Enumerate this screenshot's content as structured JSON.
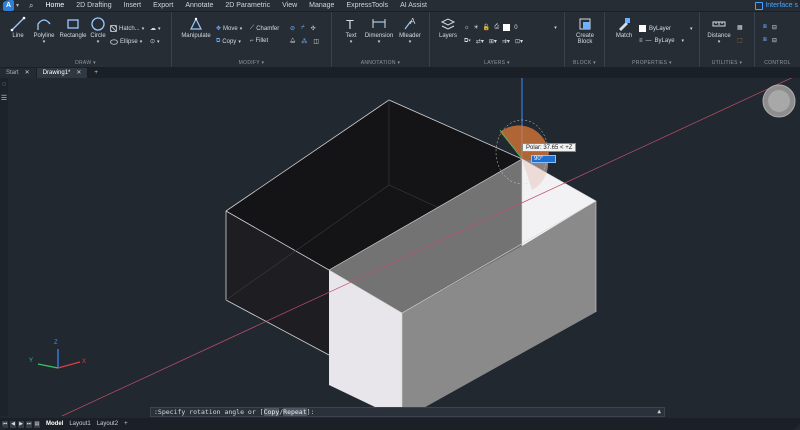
{
  "app": {
    "logo": "A",
    "menu_tabs": [
      "Home",
      "2D Drafting",
      "Insert",
      "Export",
      "Annotate",
      "2D Parametric",
      "View",
      "Manage",
      "ExpressTools",
      "AI Assist"
    ],
    "active_tab": "Home",
    "interface_label": "Interface s"
  },
  "ribbon": {
    "draw": {
      "title": "DRAW",
      "line": "Line",
      "polyline": "Polyline",
      "rectangle": "Rectangle",
      "circle": "Circle",
      "hatch": "Hatch...",
      "ellipse": "Ellipse"
    },
    "modify": {
      "title": "MODIFY",
      "manipulate": "Manipulate",
      "move": "Move",
      "copy": "Copy",
      "chamfer": "Chamfer",
      "fillet": "Fillet"
    },
    "annotation": {
      "title": "ANNOTATION",
      "text": "Text",
      "dimension": "Dimension",
      "mleader": "Mleader"
    },
    "layers": {
      "title": "LAYERS",
      "layers": "Layers",
      "current_layer": "0"
    },
    "block": {
      "title": "BLOCK",
      "create_block_line1": "Create",
      "create_block_line2": "Block"
    },
    "properties": {
      "title": "PROPERTIES",
      "match": "Match",
      "color": "ByLayer",
      "linetype": "ByLaye"
    },
    "utilities": {
      "title": "UTILITIES",
      "distance": "Distance"
    },
    "control": {
      "title": "CONTROL"
    }
  },
  "doc_tabs": {
    "start": "Start",
    "drawing": "Drawing1*",
    "close": "✕",
    "add": "+"
  },
  "viewport": {
    "polar_tooltip": "Polar: 37.65 < +Z",
    "angle_value": "90°",
    "ucs_x": "X",
    "ucs_y": "Y",
    "ucs_z": "Z"
  },
  "command": {
    "prefix": ":Specify rotation angle or [",
    "opt1": "Copy",
    "sep": "/",
    "opt2": "Repeat",
    "suffix": "]:",
    "caret": "▲"
  },
  "statusbar": {
    "model": "Model",
    "layout1": "Layout1",
    "layout2": "Layout2",
    "add": "+"
  },
  "colors": {
    "accent": "#2f8cff",
    "background": "#212830",
    "polar_line": "#c0506b"
  }
}
